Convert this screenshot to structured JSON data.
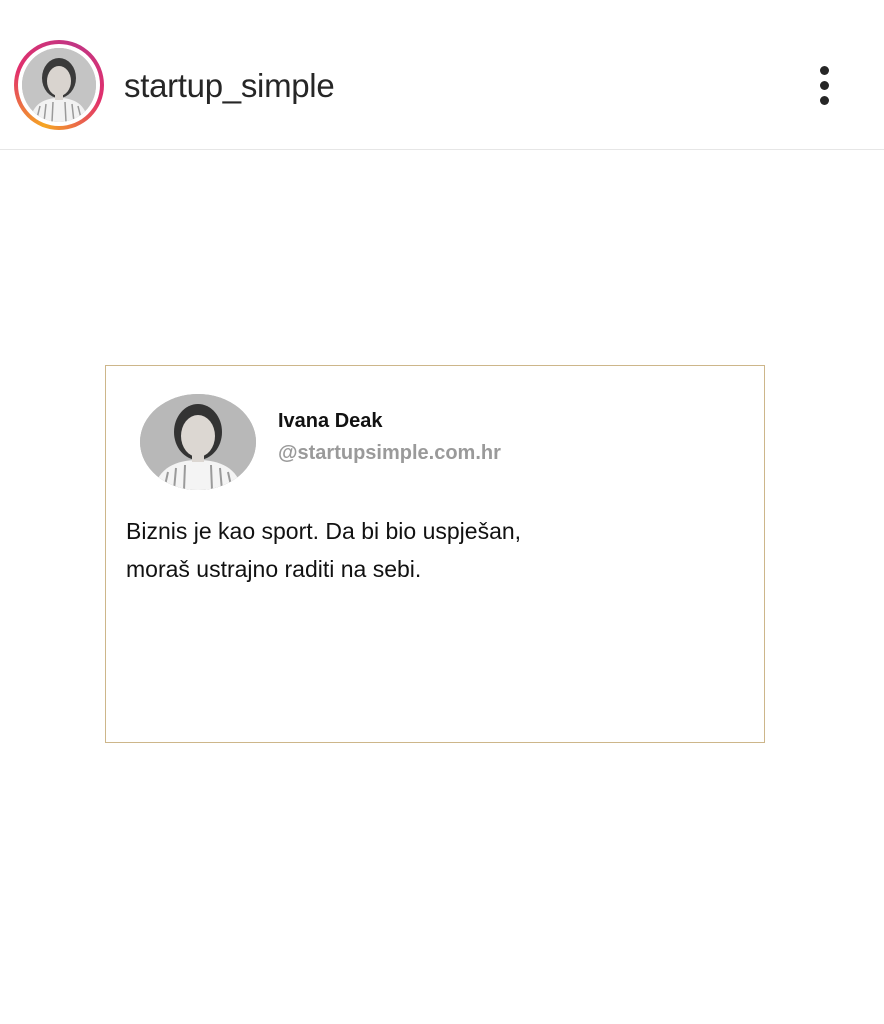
{
  "header": {
    "username": "startup_simple",
    "avatar_icon": "profile-photo",
    "more_icon": "more-vertical-icon"
  },
  "post": {
    "card": {
      "author_name": "Ivana Deak",
      "author_handle": "@startupsimple.com.hr",
      "text_lines": [
        "Biznis je kao sport. Da bi bio uspješan,",
        "moraš ustrajno raditi na sebi."
      ]
    }
  },
  "colors": {
    "ring_gradient": [
      "#f5a623",
      "#e1306c",
      "#c13584"
    ],
    "card_border": "#cdb68a",
    "handle_gray": "#9a9a9a",
    "text_dark": "#262626"
  }
}
